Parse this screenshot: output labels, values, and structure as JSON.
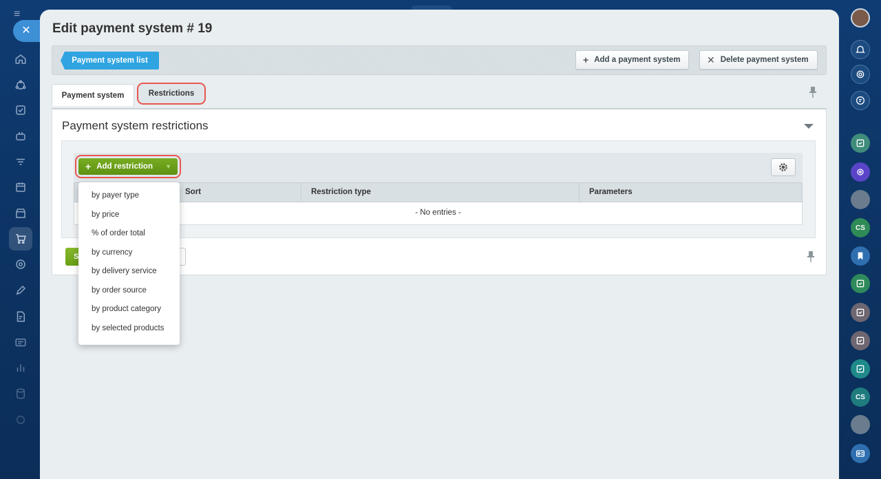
{
  "page": {
    "title": "Edit payment system # 19"
  },
  "toolbar": {
    "list_label": "Payment system list",
    "add_label": "Add a payment system",
    "delete_label": "Delete payment system"
  },
  "tabs": [
    {
      "label": "Payment system",
      "active": true
    },
    {
      "label": "Restrictions",
      "highlighted": true
    }
  ],
  "section": {
    "title": "Payment system restrictions"
  },
  "grid": {
    "add_restriction_label": "Add restriction",
    "columns": [
      "Sort",
      "Restriction type",
      "Parameters"
    ],
    "empty_text": "- No entries -"
  },
  "footer": {
    "save_label_partial": "S"
  },
  "dropdown": {
    "items": [
      "by payer type",
      "by price",
      "% of order total",
      "by currency",
      "by delivery service",
      "by order source",
      "by product category",
      "by selected products"
    ]
  },
  "right_bar": {
    "initials_1": "CS",
    "initials_2": "CS"
  },
  "colors": {
    "accent_blue": "#2fa4e0",
    "add_green": "#6a9e16",
    "highlight_red": "#e8554e",
    "background_navy": "#0f3c73"
  }
}
